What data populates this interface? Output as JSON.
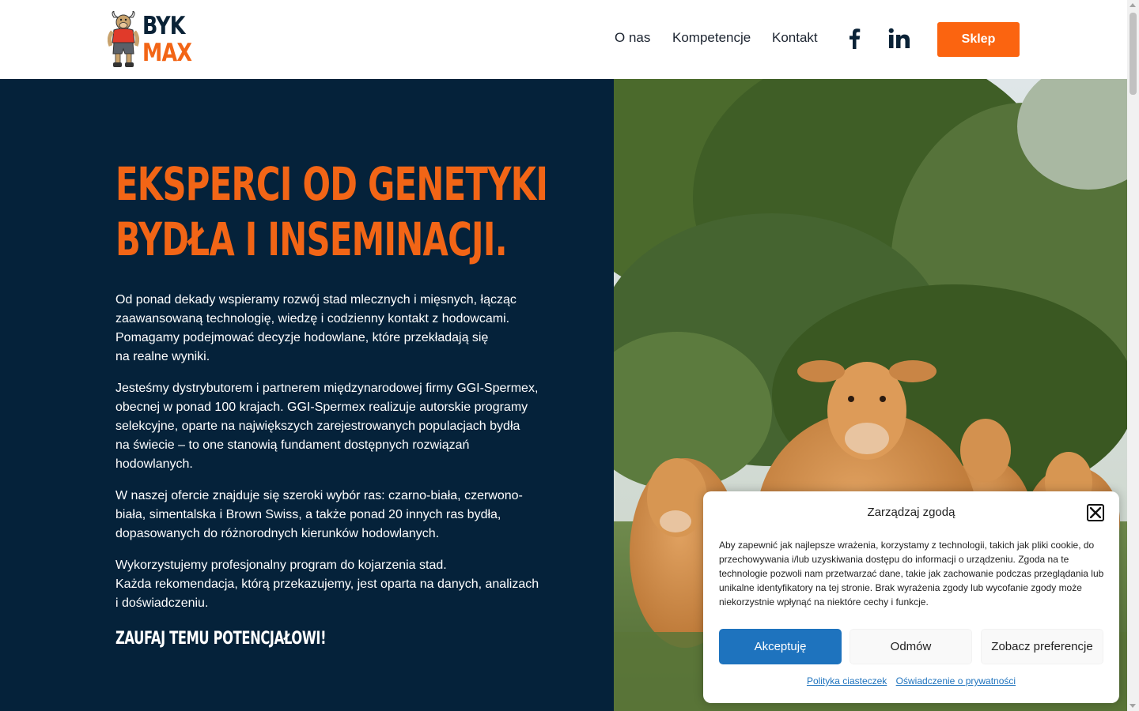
{
  "header": {
    "logo_line1": "BYK",
    "logo_line2": "MAX",
    "nav": [
      "O nas",
      "Kompetencje",
      "Kontakt"
    ],
    "social_icons": [
      "facebook-icon",
      "linkedin-icon"
    ],
    "shop_label": "Sklep"
  },
  "hero": {
    "title_line1": "EKSPERCI OD GENETYKI",
    "title_line2": "BYDŁA I INSEMINACJI.",
    "paragraph1": [
      "Od ponad dekady wspieramy rozwój stad mlecznych i mięsnych, łącząc",
      "zaawansowaną technologię, wiedzę i codzienny kontakt z hodowcami.",
      "Pomagamy podejmować decyzje hodowlane, które przekładają się",
      "na realne wyniki."
    ],
    "paragraph2": [
      "Jesteśmy dystrybutorem i partnerem międzynarodowej firmy GGI-Spermex,",
      "obecnej w ponad 100 krajach. GGI-Spermex realizuje autorskie programy",
      "selekcyjne, oparte na największych zarejestrowanych populacjach bydła",
      "na świecie – to one stanowią fundament dostępnych rozwiązań",
      "hodowlanych."
    ],
    "paragraph3": [
      "W naszej ofercie znajduje się szeroki wybór ras: czarno-biała, czerwono-",
      "biała, simentalska i Brown Swiss, a także ponad 20 innych ras bydła,",
      "dopasowanych do różnorodnych kierunków hodowlanych."
    ],
    "paragraph4": [
      "Wykorzystujemy profesjonalny program do kojarzenia stad.",
      "Każda rekomendacja, którą przekazujemy, jest oparta na danych, analizach",
      "i doświadczeniu."
    ],
    "tagline": "ZAUFAJ TEMU POTENCJAŁOWI!",
    "image": "cows-in-meadow-photo"
  },
  "cookie_modal": {
    "title": "Zarządzaj zgodą",
    "close_icon": "close-icon",
    "text": "Aby zapewnić jak najlepsze wrażenia, korzystamy z technologii, takich jak pliki cookie, do przechowywania i/lub uzyskiwania dostępu do informacji o urządzeniu. Zgoda na te technologie pozwoli nam przetwarzać dane, takie jak zachowanie podczas przeglądania lub unikalne identyfikatory na tej stronie. Brak wyrażenia zgody lub wycofanie zgody może niekorzystnie wpłynąć na niektóre cechy i funkcje.",
    "accept_label": "Akceptuję",
    "deny_label": "Odmów",
    "prefs_label": "Zobacz preferencje",
    "link_cookies": "Polityka ciasteczek",
    "link_privacy": "Oświadczenie o prywatności"
  },
  "colors": {
    "brand_orange": "#f26516",
    "shop_orange": "#fb6410",
    "navy": "#05223a",
    "accept_blue": "#1e73be"
  }
}
